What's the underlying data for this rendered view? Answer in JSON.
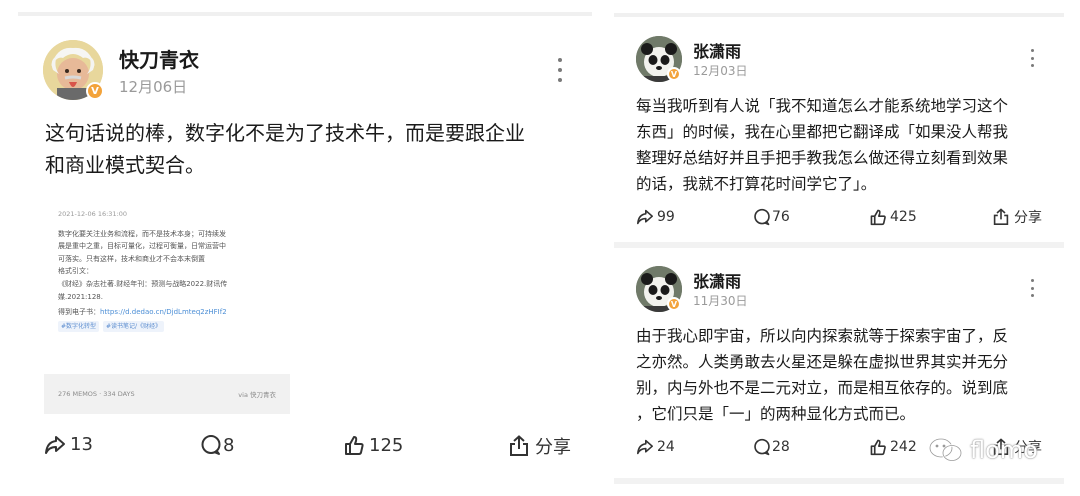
{
  "left_post": {
    "username": "快刀青衣",
    "date": "12月06日",
    "text_line1": "这句话说的棒，数字化不是为了技术牛，而是要跟企业",
    "text_line2": "和商业模式契合。",
    "memo": {
      "time": "2021-12-06 16:31:00",
      "line1": "数字化要关注业务和流程，而不是技术本身；可持续发",
      "line2": "展是重中之重，目标可量化，过程可衡量，日常运营中",
      "line3": "可落实。只有这样，技术和商业才不会本末倒置",
      "line4": "格式引文：",
      "line5": "《财经》杂志社著.财经年刊：预测与战略2022.财讯传",
      "line6": "媒.2021:128.",
      "link_prefix": "得到电子书：",
      "link": "https://d.dedao.cn/DjdLmteq2zHFIf2",
      "tag1": "#数字化转型",
      "tag2": "#读书笔记/《财经》",
      "footer_left": "276 MEMOS · 334 DAYS",
      "footer_right": "via 快刀青衣"
    },
    "share_count": "13",
    "comment_count": "8",
    "like_count": "125",
    "share_label": "分享"
  },
  "right_posts": [
    {
      "username": "张潇雨",
      "date": "12月03日",
      "line1": "每当我听到有人说「我不知道怎么才能系统地学习这个",
      "line2": "东西」的时候，我在心里都把它翻译成「如果没人帮我",
      "line3": "整理好总结好并且手把手教我怎么做还得立刻看到效果",
      "line4": "的话，我就不打算花时间学它了」。",
      "share_count": "99",
      "comment_count": "76",
      "like_count": "425",
      "share_label": "分享"
    },
    {
      "username": "张潇雨",
      "date": "11月30日",
      "line1": "由于我心即宇宙，所以向内探索就等于探索宇宙了，反",
      "line2": "之亦然。人类勇敢去火星还是躲在虚拟世界其实并无分",
      "line3": "别，内与外也不是二元对立，而是相互依存的。说到底",
      "line4": "，它们只是「一」的两种显化方式而已。",
      "share_count": "24",
      "comment_count": "28",
      "like_count": "242",
      "share_label": "分享"
    }
  ],
  "watermark": {
    "text": "flomo",
    "icon": "wechat-icon"
  },
  "colors": {
    "verified_badge": "#f3a33b",
    "link": "#4d8fd6",
    "date_gray": "#9a9a9a"
  }
}
